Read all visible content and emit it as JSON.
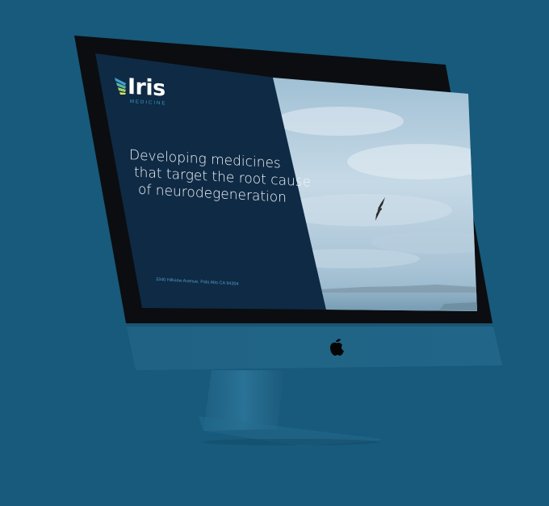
{
  "colors": {
    "background": "#175a7b",
    "screen_panel": "#0f2a44",
    "monitor_body": "#1e5e82",
    "logo_accent": "#3ea0cf"
  },
  "website": {
    "brand": {
      "name": "Iris",
      "subtitle": "MEDICINE",
      "icon": "wing-icon"
    },
    "headline": [
      "Developing medicines",
      "that target the root cause",
      "of neurodegeneration"
    ],
    "address": "3340 Hillview Avenue, Palo Alto CA 94304",
    "hero_image": "sky-with-bird-over-sea"
  },
  "device": {
    "logo_icon": "apple-logo-icon"
  }
}
